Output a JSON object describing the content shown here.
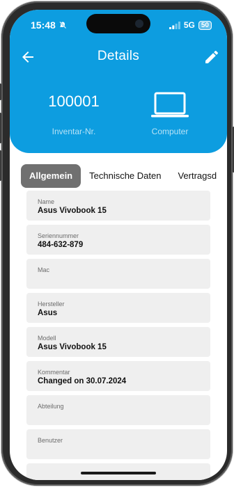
{
  "status_bar": {
    "time": "15:48",
    "network": "5G",
    "battery": "50"
  },
  "header": {
    "title": "Details",
    "inventory_number": "100001",
    "inventory_label": "Inventar-Nr.",
    "category": "Computer",
    "background_color": "#0d9de0"
  },
  "tabs": [
    {
      "label": "Allgemein",
      "active": true
    },
    {
      "label": "Technische Daten",
      "active": false
    },
    {
      "label": "Vertragsd",
      "active": false
    }
  ],
  "fields": [
    {
      "label": "Name",
      "value": "Asus Vivobook 15"
    },
    {
      "label": "Seriennummer",
      "value": "484-632-879"
    },
    {
      "label": "Mac",
      "value": ""
    },
    {
      "label": "Hersteller",
      "value": "Asus"
    },
    {
      "label": "Modell",
      "value": "Asus Vivobook 15"
    },
    {
      "label": "Kommentar",
      "value": "Changed on 30.07.2024"
    },
    {
      "label": "Abteilung",
      "value": ""
    },
    {
      "label": "Benutzer",
      "value": ""
    },
    {
      "label": "",
      "value": ""
    }
  ]
}
